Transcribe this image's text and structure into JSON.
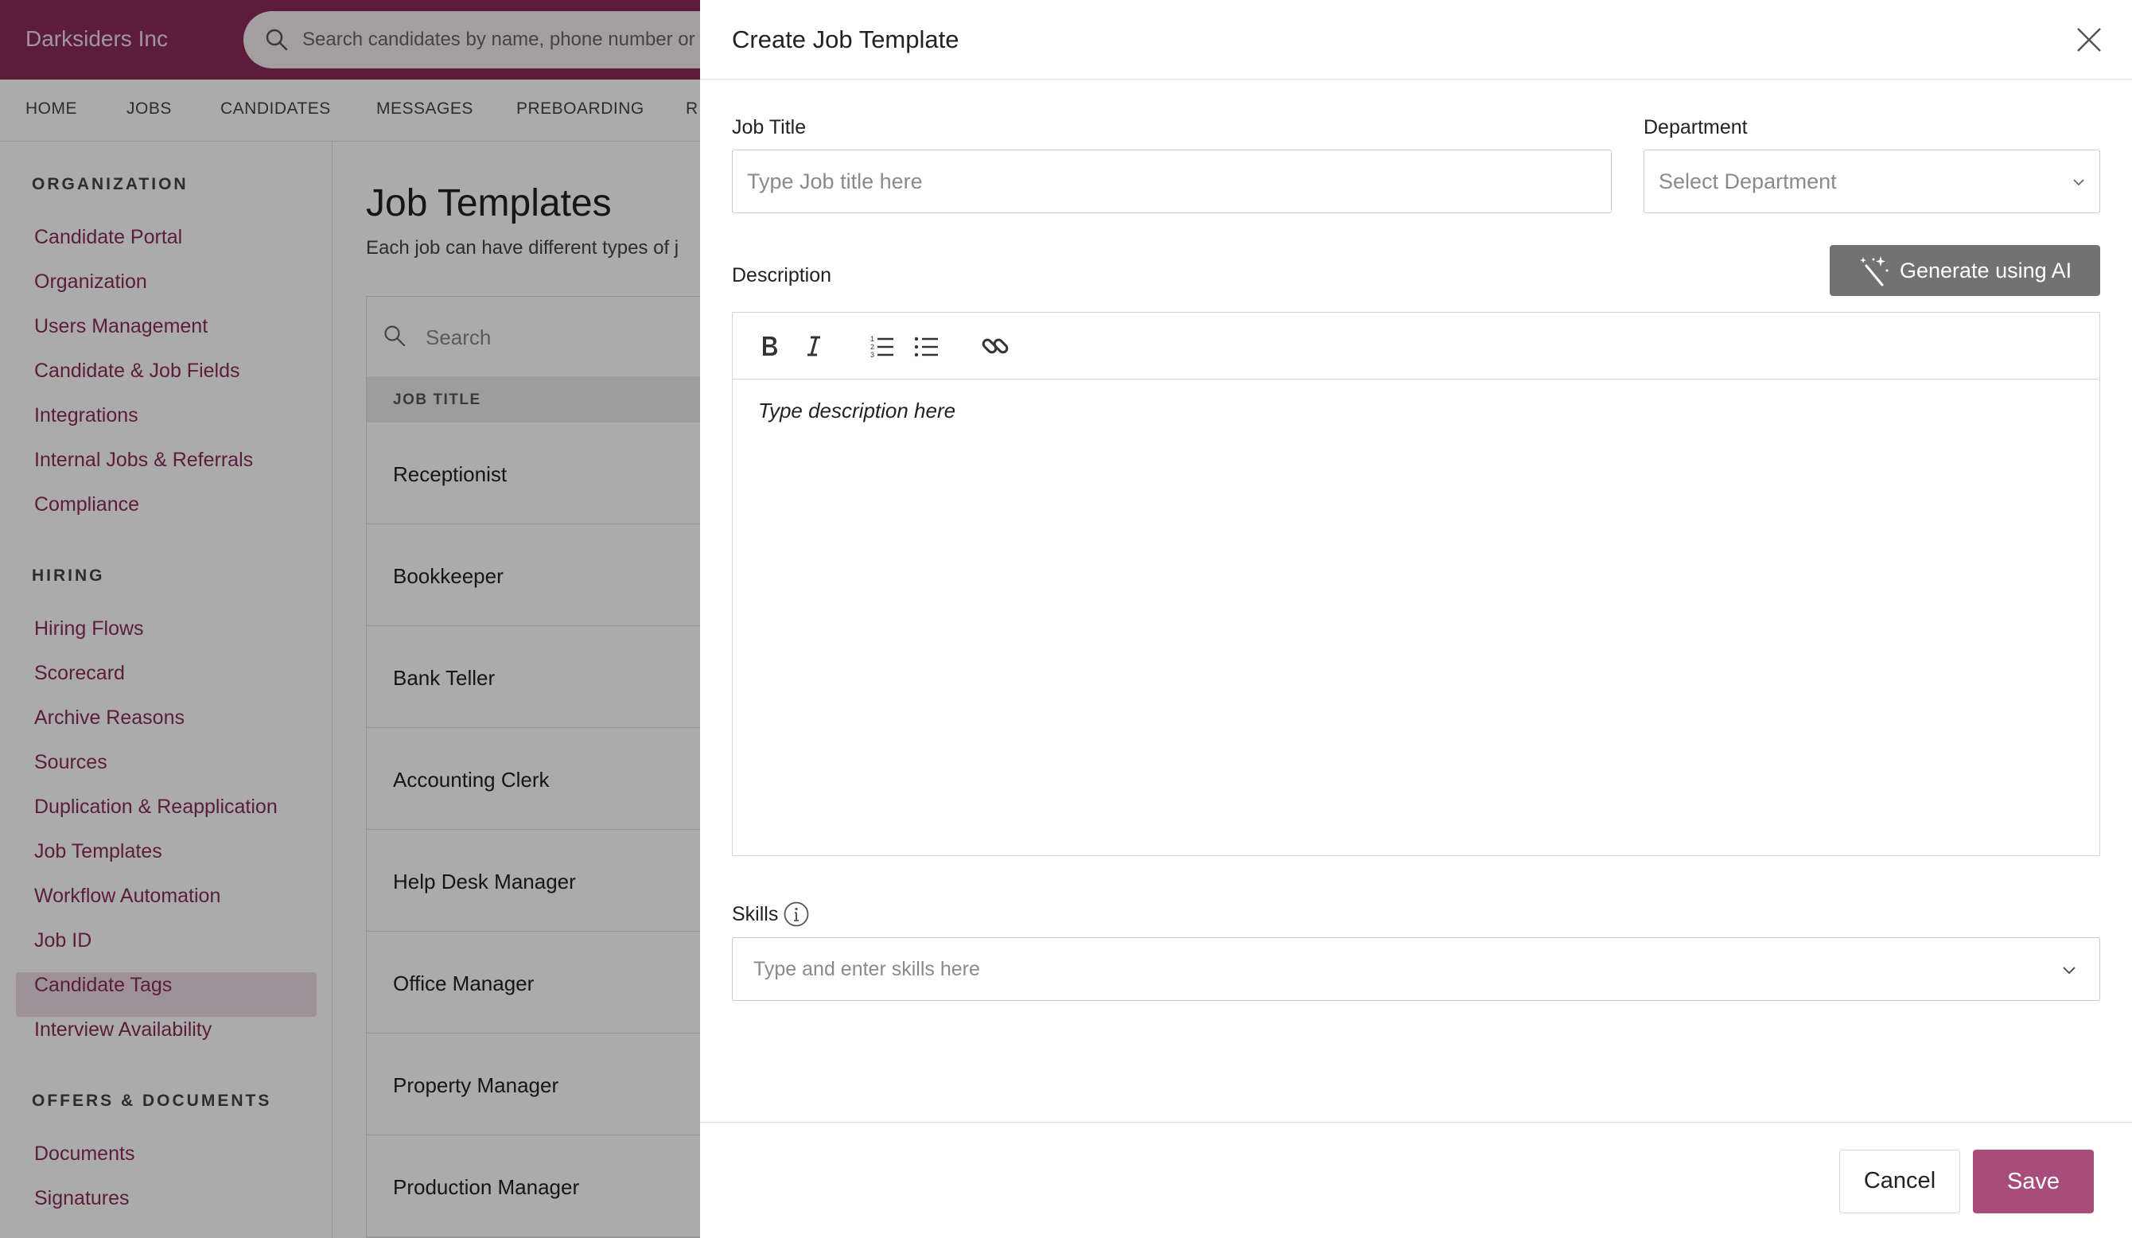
{
  "app": {
    "company": "Darksiders Inc",
    "global_search_placeholder": "Search candidates by name, phone number or e",
    "nav": [
      "HOME",
      "JOBS",
      "CANDIDATES",
      "MESSAGES",
      "PREBOARDING",
      "R"
    ]
  },
  "sidebar": {
    "sections": [
      {
        "title": "ORGANIZATION",
        "items": [
          "Candidate Portal",
          "Organization",
          "Users Management",
          "Candidate & Job Fields",
          "Integrations",
          "Internal Jobs & Referrals",
          "Compliance"
        ]
      },
      {
        "title": "HIRING",
        "items": [
          "Hiring Flows",
          "Scorecard",
          "Archive Reasons",
          "Sources",
          "Duplication & Reapplication",
          "Job Templates",
          "Workflow Automation",
          "Job ID",
          "Candidate Tags",
          "Interview Availability"
        ]
      },
      {
        "title": "OFFERS & DOCUMENTS",
        "items": [
          "Documents",
          "Signatures"
        ]
      }
    ],
    "active_item": "Job Templates"
  },
  "main": {
    "title": "Job Templates",
    "subtitle": "Each job can have different types of j",
    "search_placeholder": "Search",
    "column_header": "JOB TITLE",
    "rows": [
      "Receptionist",
      "Bookkeeper",
      "Bank Teller",
      "Accounting Clerk",
      "Help Desk Manager",
      "Office Manager",
      "Property Manager",
      "Production Manager"
    ]
  },
  "drawer": {
    "title": "Create Job Template",
    "job_title_label": "Job Title",
    "job_title_placeholder": "Type Job title here",
    "department_label": "Department",
    "department_placeholder": "Select Department",
    "description_label": "Description",
    "ai_button": "Generate using AI",
    "description_placeholder": "Type description here",
    "toolbar_icons": [
      "bold-icon",
      "italic-icon",
      "ordered-list-icon",
      "bullet-list-icon",
      "link-icon"
    ],
    "skills_label": "Skills",
    "skills_placeholder": "Type and enter skills here",
    "cancel": "Cancel",
    "save": "Save"
  },
  "colors": {
    "brand": "#8a2c5a",
    "save_button": "#a84d7a",
    "ai_button": "#727272",
    "active_sidebar": "#ecd9e2"
  }
}
